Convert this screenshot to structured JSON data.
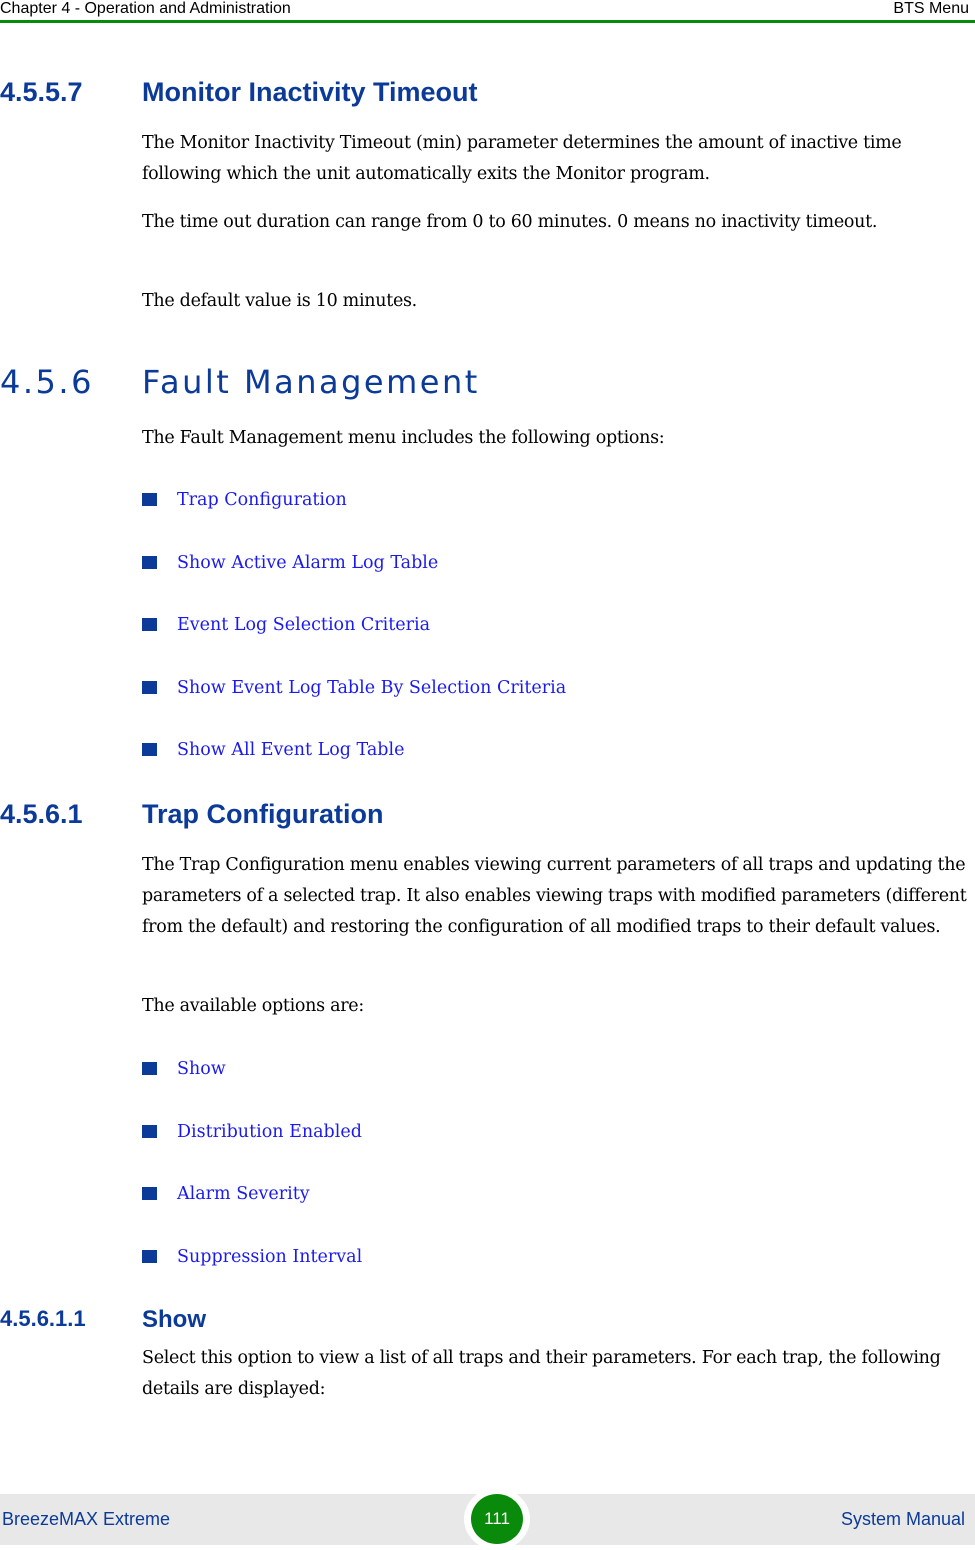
{
  "header": {
    "chapter": "Chapter 4 - Operation and Administration",
    "section": "BTS Menu"
  },
  "sections": {
    "s4557": {
      "number": "4.5.5.7",
      "title": "Monitor Inactivity Timeout",
      "paragraphs": [
        "The Monitor Inactivity Timeout (min) parameter determines the amount of inactive time following which the unit automatically exits the Monitor program.",
        "The time out duration can range from 0 to 60 minutes. 0 means no inactivity timeout.",
        "The default value is 10 minutes."
      ]
    },
    "s456": {
      "number": "4.5.6",
      "title": "Fault Management",
      "intro": "The Fault Management menu includes the following options:",
      "options": [
        "Trap Configuration",
        "Show Active Alarm Log Table",
        "Event Log Selection Criteria",
        "Show Event Log Table By Selection Criteria",
        "Show All Event Log Table"
      ]
    },
    "s4561": {
      "number": "4.5.6.1",
      "title": "Trap Configuration",
      "paragraphs": [
        "The Trap Configuration menu enables viewing current parameters of all traps and updating the parameters of a selected trap. It also enables viewing traps with modified parameters (different from the default) and restoring the configuration of all modified traps to their default values.",
        "The available options are:"
      ],
      "options": [
        "Show",
        "Distribution Enabled",
        "Alarm Severity",
        "Suppression Interval"
      ]
    },
    "s45611": {
      "number": "4.5.6.1.1",
      "title": "Show",
      "paragraph": "Select this option to view a list of all traps and their parameters. For each trap, the following details are displayed:"
    }
  },
  "footer": {
    "product": "BreezeMAX Extreme",
    "page_number": "111",
    "doc_type": "System Manual"
  }
}
